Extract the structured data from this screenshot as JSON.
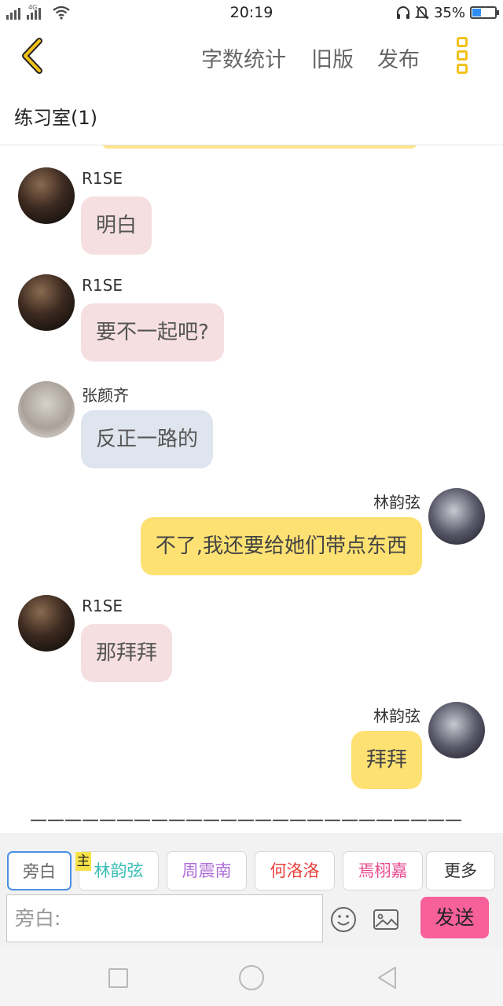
{
  "status_bar": {
    "network": "4G",
    "time": "20:19",
    "battery": "35%",
    "battery_level": 0.35,
    "icons": [
      "signal-icon",
      "wifi-icon",
      "headphones-icon",
      "mute-bell-icon",
      "battery-icon"
    ]
  },
  "top_bar": {
    "back_icon": "chevron-left-icon",
    "word_count": "字数统计",
    "old_version": "旧版",
    "publish": "发布",
    "more_icon": "more-vertical-icon",
    "accent_color": "#f2c21b"
  },
  "room": {
    "title": "练习室(1)"
  },
  "messages": [
    {
      "sender": "R1SE",
      "text": "明白",
      "side": "left",
      "bubble_color": "#f5dfe1"
    },
    {
      "sender": "R1SE",
      "text": "要不一起吧?",
      "side": "left",
      "bubble_color": "#f5dfe1"
    },
    {
      "sender": "张颜齐",
      "text": "反正一路的",
      "side": "left",
      "bubble_color": "#dfe5ee"
    },
    {
      "sender": "林韵弦",
      "text": "不了,我还要给她们带点东西",
      "side": "right",
      "bubble_color": "#fde172"
    },
    {
      "sender": "R1SE",
      "text": "那拜拜",
      "side": "left",
      "bubble_color": "#f5dfe1"
    },
    {
      "sender": "林韵弦",
      "text": "拜拜",
      "side": "right",
      "bubble_color": "#fde172"
    }
  ],
  "divider": "—————————————————————————",
  "roles": {
    "host_badge": "主",
    "items": [
      {
        "label": "旁白",
        "color": "#666666",
        "selected": true
      },
      {
        "label": "林韵弦",
        "color": "#3bbfb6",
        "selected": false
      },
      {
        "label": "周震南",
        "color": "#b06fd8",
        "selected": false
      },
      {
        "label": "何洛洛",
        "color": "#e8413c",
        "selected": false
      },
      {
        "label": "焉栩嘉",
        "color": "#e94a8f",
        "selected": false
      },
      {
        "label": "更多",
        "color": "#333333",
        "selected": false
      }
    ]
  },
  "input": {
    "placeholder": "旁白:",
    "value": ""
  },
  "send": {
    "label": "发送",
    "color": "#f7609a"
  },
  "input_icons": [
    "emoji-icon",
    "image-icon"
  ],
  "nav_icons": [
    "recent-apps-icon",
    "home-icon",
    "back-icon"
  ]
}
